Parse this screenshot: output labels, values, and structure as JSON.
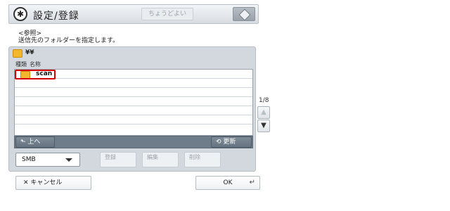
{
  "header": {
    "title": "設定/登録",
    "status_text": "ちょうどよい",
    "instruction_line1": "<参照>",
    "instruction_line2": "送信先のフォルダーを指定します。"
  },
  "path": {
    "text": "¥¥"
  },
  "list": {
    "col_type": "種類",
    "col_name": "名称",
    "rows": [
      {
        "name": "scan",
        "selected": true
      }
    ]
  },
  "pager": {
    "page": "1/8"
  },
  "controls": {
    "up_label": "上へ",
    "refresh_label": "更新",
    "protocol_value": "SMB",
    "register_label": "登録",
    "edit_label": "編集",
    "delete_label": "削除"
  },
  "footer": {
    "cancel_label": "キャンセル",
    "ok_label": "OK"
  },
  "colors": {
    "selection_outline": "#d60000",
    "panel_bg": "#d2d8de",
    "bar_bg": "#6f7c89"
  },
  "icons": [
    "settings-icon",
    "device-icon",
    "folder-icon",
    "up-arrow-icon",
    "refresh-icon",
    "chevron-down-icon",
    "cancel-x-icon",
    "enter-icon"
  ]
}
